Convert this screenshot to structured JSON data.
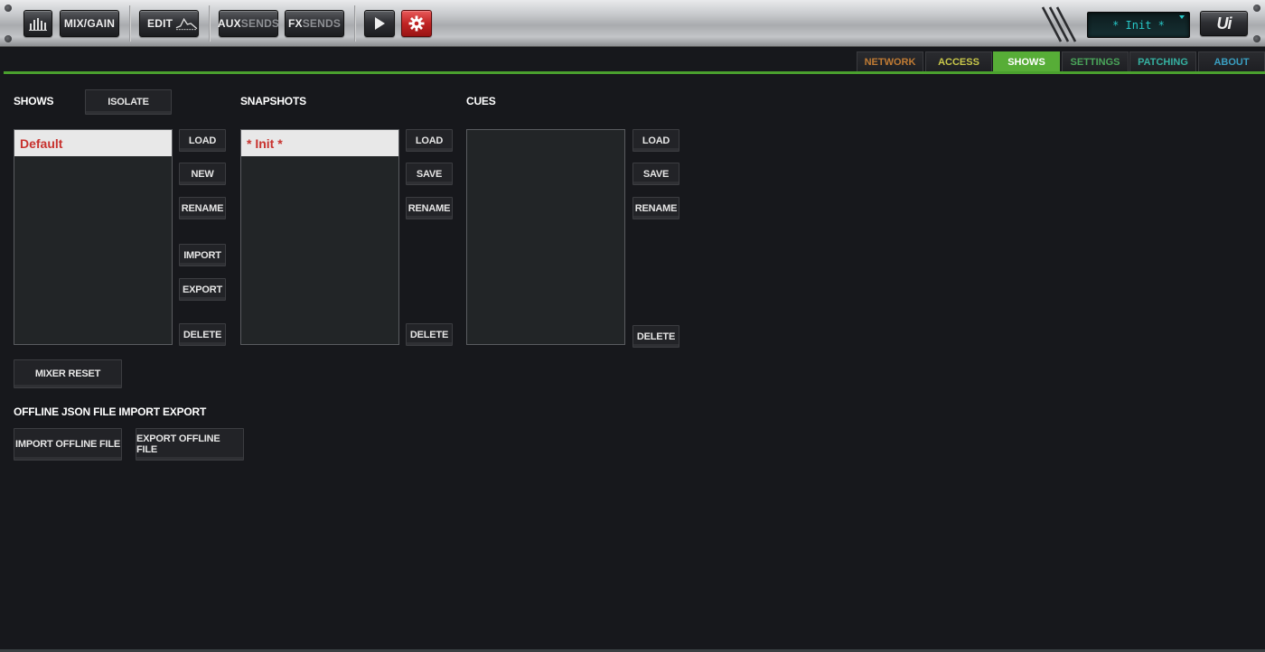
{
  "toolbar": {
    "mix_gain_label": "MIX/GAIN",
    "edit_label": "EDIT",
    "aux_label_bold": "AUX",
    "aux_label_dim": "SENDS",
    "fx_label_bold": "FX",
    "fx_label_dim": "SENDS",
    "lcd_text": "* Init *",
    "logo_text": "Ui",
    "icons": {
      "meters": "meters-icon",
      "play": "play-icon",
      "settings": "gear-icon",
      "eq": "eq-curve-icon"
    },
    "accent_color": "#c02424"
  },
  "tabs": [
    {
      "label": "NETWORK",
      "color": "#c07b34"
    },
    {
      "label": "ACCESS",
      "color": "#c9c84a"
    },
    {
      "label": "SHOWS",
      "color": "#ffffff"
    },
    {
      "label": "SETTINGS",
      "color": "#4aa55a"
    },
    {
      "label": "PATCHING",
      "color": "#35b0a0"
    },
    {
      "label": "ABOUT",
      "color": "#3a9ec0"
    }
  ],
  "active_tab": "SHOWS",
  "shows": {
    "heading": "SHOWS",
    "isolate_label": "ISOLATE",
    "items": [
      "Default"
    ],
    "load_label": "LOAD",
    "new_label": "NEW",
    "rename_label": "RENAME",
    "import_label": "IMPORT",
    "export_label": "EXPORT",
    "delete_label": "DELETE"
  },
  "snapshots": {
    "heading": "SNAPSHOTS",
    "items": [
      "* Init *"
    ],
    "load_label": "LOAD",
    "save_label": "SAVE",
    "rename_label": "RENAME",
    "delete_label": "DELETE"
  },
  "cues": {
    "heading": "CUES",
    "items": [],
    "load_label": "LOAD",
    "save_label": "SAVE",
    "rename_label": "RENAME",
    "delete_label": "DELETE"
  },
  "mixer_reset_label": "MIXER RESET",
  "offline": {
    "heading": "OFFLINE JSON FILE IMPORT EXPORT",
    "import_label": "IMPORT OFFLINE FILE",
    "export_label": "EXPORT OFFLINE FILE"
  }
}
